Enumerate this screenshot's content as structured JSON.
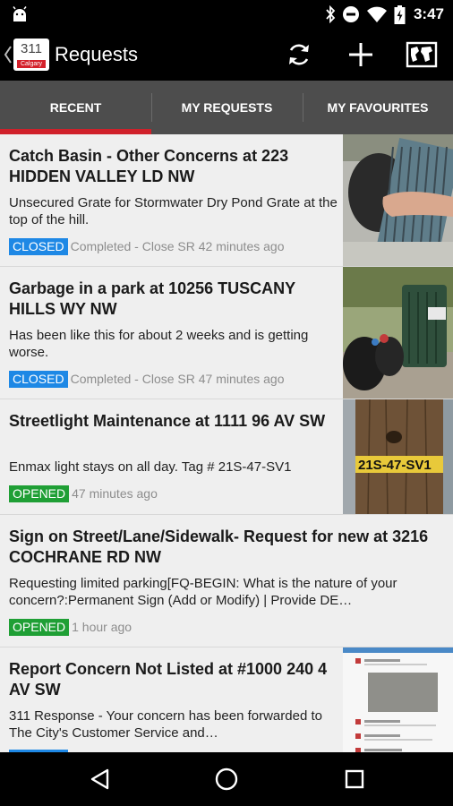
{
  "status_bar": {
    "time": "3:47",
    "icons": [
      "android-icon",
      "bluetooth-icon",
      "do-not-disturb-icon",
      "wifi-icon",
      "battery-icon"
    ]
  },
  "app_bar": {
    "logo_text": "311",
    "logo_tag": "Calgary",
    "title": "Requests",
    "actions": [
      "refresh-icon",
      "add-icon",
      "map-icon"
    ]
  },
  "tabs": [
    {
      "label": "RECENT",
      "selected": true
    },
    {
      "label": "MY REQUESTS",
      "selected": false
    },
    {
      "label": "MY FAVOURITES",
      "selected": false
    }
  ],
  "colors": {
    "accent": "#d0202a",
    "closed": "#1e88e5",
    "opened": "#1f9f35"
  },
  "requests": [
    {
      "title": "Catch Basin - Other Concerns at 223 HIDDEN VALLEY LD NW",
      "description": "Unsecured Grate for Stormwater Dry Pond Grate at the top of the hill.",
      "status": "CLOSED",
      "status_text": "Completed - Close SR 42 minutes ago",
      "thumbnail": "storm-grate-photo"
    },
    {
      "title": "Garbage in a park at 10256 TUSCANY HILLS WY NW",
      "description": "Has been like this for about 2 weeks and is getting worse.",
      "status": "CLOSED",
      "status_text": "Completed - Close SR 47 minutes ago",
      "thumbnail": "garbage-bin-photo"
    },
    {
      "title": "Streetlight Maintenance at 1111 96 AV SW",
      "description": "Enmax light stays on all day. Tag # 21S-47-SV1",
      "status": "OPENED",
      "status_text": "47 minutes ago",
      "thumbnail": "streetlight-pole-photo",
      "thumbnail_tag": "21S-47-SV1"
    },
    {
      "title": "Sign on Street/Lane/Sidewalk- Request for new at 3216 COCHRANE RD NW",
      "description": "Requesting limited parking[FQ-BEGIN: What is the nature of your concern?:Permanent Sign (Add or Modify) | Provide DE…",
      "status": "OPENED",
      "status_text": "1 hour ago"
    },
    {
      "title": "Report Concern Not Listed at #1000 240 4 AV SW",
      "description": "311 Response - Your concern has been forwarded to The City's Customer Service and…",
      "thumbnail": "screenshot-photo"
    }
  ],
  "nav_bar": [
    "back-icon",
    "home-icon",
    "recents-icon"
  ]
}
